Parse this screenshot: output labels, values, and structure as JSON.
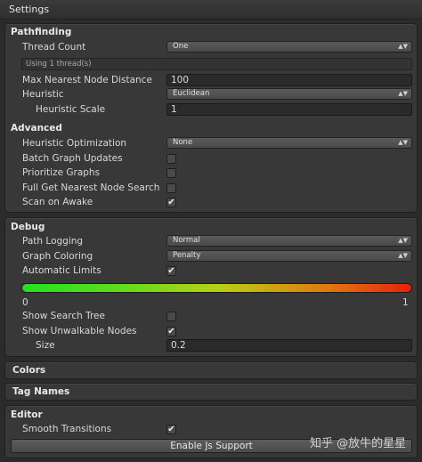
{
  "window": {
    "title": "Settings"
  },
  "pathfinding": {
    "header": "Pathfinding",
    "thread_count_label": "Thread Count",
    "thread_count_value": "One",
    "thread_info": "Using 1 thread(s)",
    "max_nearest_label": "Max Nearest Node Distance",
    "max_nearest_value": "100",
    "heuristic_label": "Heuristic",
    "heuristic_value": "Euclidean",
    "heuristic_scale_label": "Heuristic Scale",
    "heuristic_scale_value": "1"
  },
  "advanced": {
    "header": "Advanced",
    "heuristic_opt_label": "Heuristic Optimization",
    "heuristic_opt_value": "None",
    "batch_label": "Batch Graph Updates",
    "batch_checked": false,
    "prioritize_label": "Prioritize Graphs",
    "prioritize_checked": false,
    "full_get_label": "Full Get Nearest Node Search",
    "full_get_checked": false,
    "scan_label": "Scan on Awake",
    "scan_checked": true
  },
  "debug": {
    "header": "Debug",
    "path_logging_label": "Path Logging",
    "path_logging_value": "Normal",
    "graph_coloring_label": "Graph Coloring",
    "graph_coloring_value": "Penalty",
    "auto_limits_label": "Automatic Limits",
    "auto_limits_checked": true,
    "gradient_min": "0",
    "gradient_max": "1",
    "gradient_colors": [
      "#23e023",
      "#b8d015",
      "#e8220c"
    ],
    "search_tree_label": "Show Search Tree",
    "search_tree_checked": false,
    "unwalkable_label": "Show Unwalkable Nodes",
    "unwalkable_checked": true,
    "size_label": "Size",
    "size_value": "0.2"
  },
  "colors": {
    "header": "Colors"
  },
  "tag_names": {
    "header": "Tag Names"
  },
  "editor": {
    "header": "Editor",
    "smooth_label": "Smooth Transitions",
    "smooth_checked": true,
    "js_button": "Enable Js Support"
  },
  "watermark": "知乎 @放牛的星星",
  "icons": {
    "check": "✔",
    "dropdown_arrows": "▲▼"
  }
}
